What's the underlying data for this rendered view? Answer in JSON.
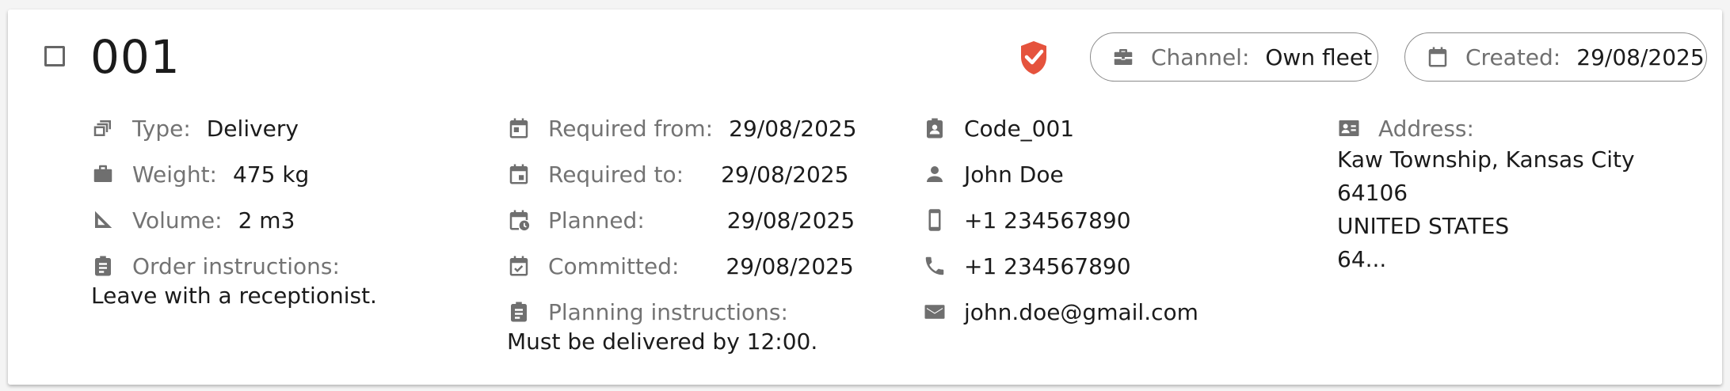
{
  "order": {
    "number": "001",
    "channel": {
      "label": "Channel:",
      "value": "Own fleet"
    },
    "created": {
      "label": "Created:",
      "value": "29/08/2025"
    }
  },
  "details": {
    "type": {
      "label": "Type:",
      "value": "Delivery"
    },
    "weight": {
      "label": "Weight:",
      "value": "475 kg"
    },
    "volume": {
      "label": "Volume:",
      "value": "2 m3"
    },
    "order_instructions": {
      "label": "Order instructions:",
      "value": "Leave with a receptionist."
    }
  },
  "schedule": {
    "required_from": {
      "label": "Required from:",
      "value": "29/08/2025"
    },
    "required_to": {
      "label": "Required to:",
      "value": "29/08/2025"
    },
    "planned": {
      "label": "Planned:",
      "value": "29/08/2025"
    },
    "committed": {
      "label": "Committed:",
      "value": "29/08/2025"
    },
    "planning_instructions": {
      "label": "Planning instructions:",
      "value": "Must be delivered by 12:00."
    }
  },
  "contact": {
    "code": "Code_001",
    "name": "John Doe",
    "mobile": "+1 234567890",
    "phone": "+1 234567890",
    "email": "john.doe@gmail.com"
  },
  "address": {
    "label": "Address:",
    "lines": [
      "Kaw Township, Kansas City",
      "64106",
      "UNITED STATES",
      "64..."
    ]
  },
  "colors": {
    "accent": "#e5533d",
    "icon": "#6f6f6f",
    "label": "#737373",
    "text": "#1b1b1b"
  }
}
